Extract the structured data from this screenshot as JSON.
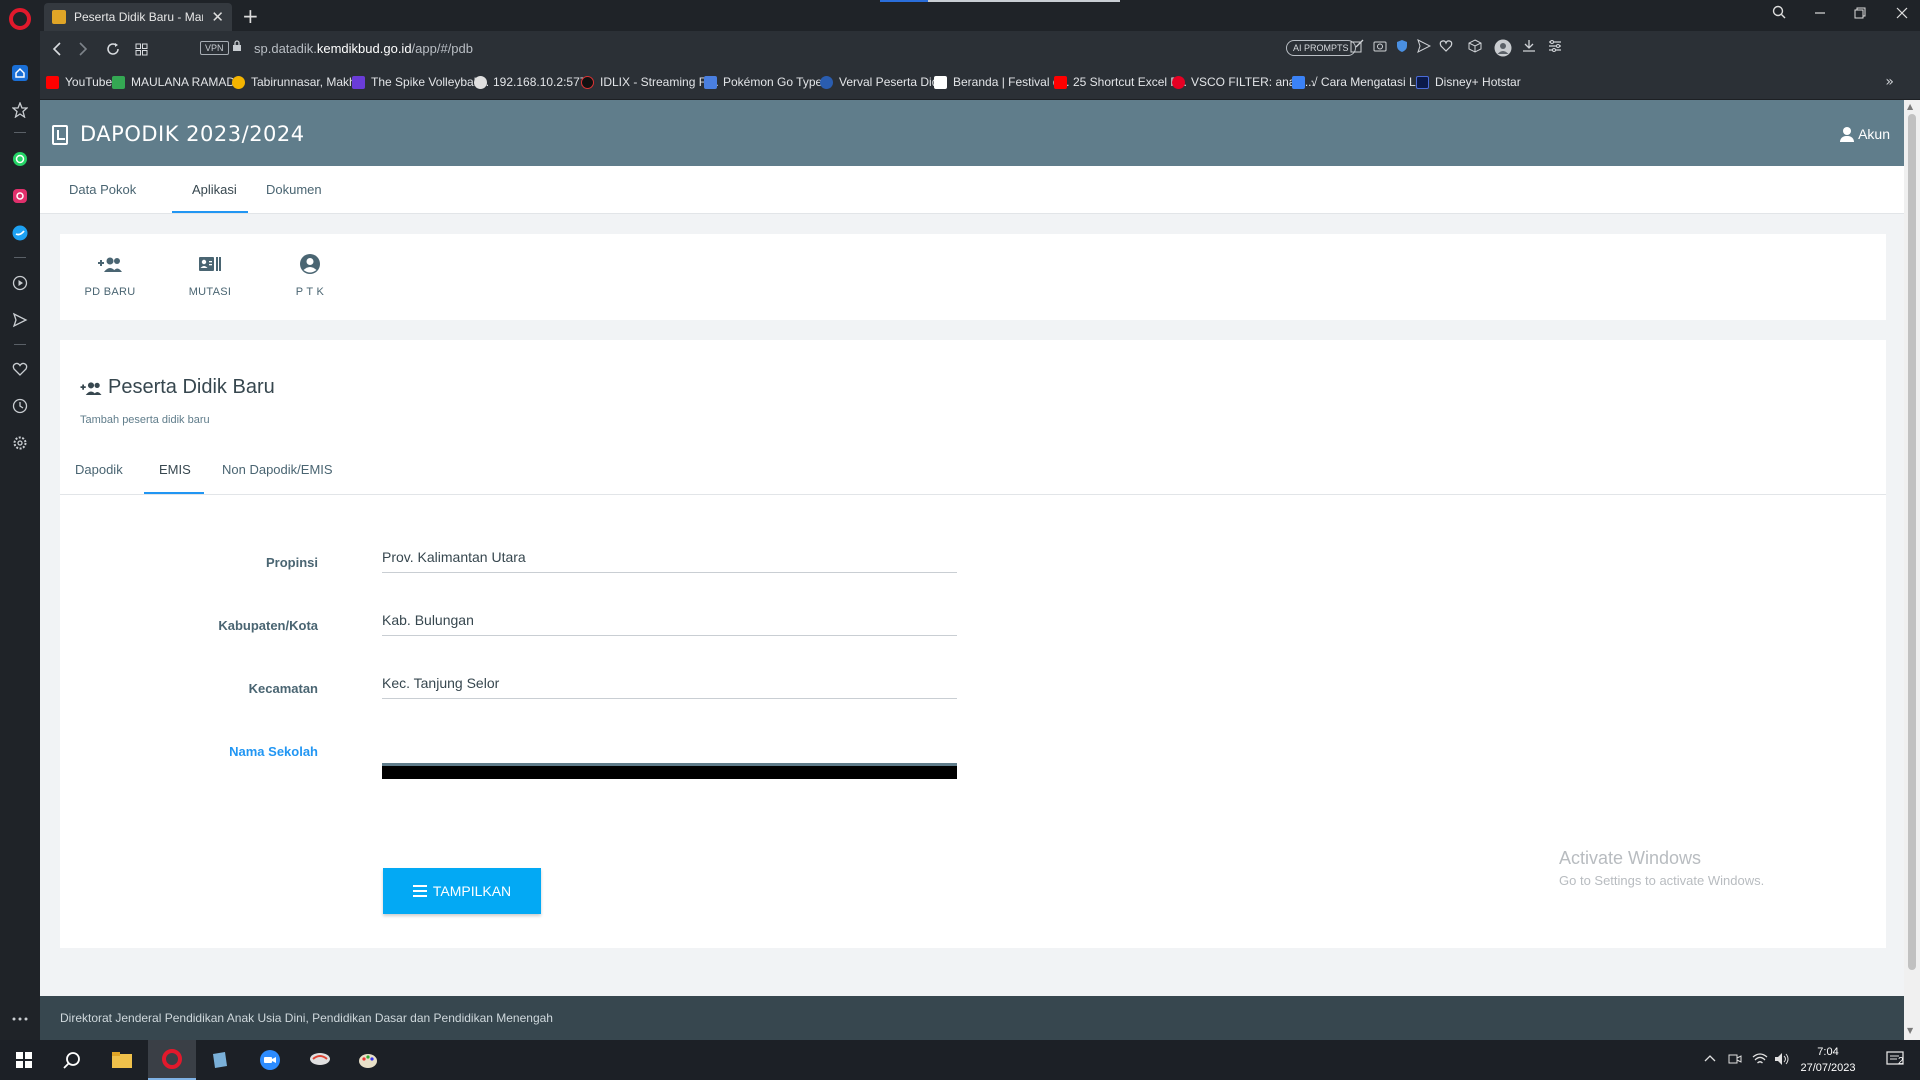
{
  "browser": {
    "tab_title": "Peserta Didik Baru - Manaj",
    "url_prefix": "sp.datadik.",
    "url_domain": "kemdikbud.go.id",
    "url_path": "/app/#/pdb",
    "vpn_label": "VPN",
    "ai_prompts_label": "AI PROMPTS",
    "new_tab": "+",
    "tab_close": "✕"
  },
  "bookmarks": [
    {
      "label": "YouTube",
      "color": "#ff0000"
    },
    {
      "label": "MAULANA RAMAD...",
      "color": "#34a853"
    },
    {
      "label": "Tabirunnasar, Makh...",
      "color": "#f4b400"
    },
    {
      "label": "The Spike Volleyball...",
      "color": "#6a3cd8"
    },
    {
      "label": "192.168.10.2:5774",
      "color": "#e0e0e0"
    },
    {
      "label": "IDLIX - Streaming Fi...",
      "color": "#111111"
    },
    {
      "label": "Pokémon Go Type...",
      "color": "#4a7fe0"
    },
    {
      "label": "Verval Peserta Didik",
      "color": "#2a5db0"
    },
    {
      "label": "Beranda | Festival d...",
      "color": "#ffffff"
    },
    {
      "label": "25 Shortcut Excel P...",
      "color": "#ff0000"
    },
    {
      "label": "VSCO FILTER: analo...",
      "color": "#e60023"
    },
    {
      "label": "√ Cara Mengatasi L...",
      "color": "#3b82f6"
    },
    {
      "label": "Disney+ Hotstar",
      "color": "#0b1a4a"
    }
  ],
  "app": {
    "title": "DAPODIK 2023/2024",
    "account_label": "Akun",
    "header_color": "#607d8b"
  },
  "main_tabs": [
    {
      "label": "Data Pokok"
    },
    {
      "label": "Aplikasi"
    },
    {
      "label": "Dokumen"
    }
  ],
  "app_buttons": [
    {
      "label": "PD BARU",
      "icon": "group-add-icon"
    },
    {
      "label": "MUTASI",
      "icon": "transfer-icon"
    },
    {
      "label": "P T K",
      "icon": "account-circle-icon"
    }
  ],
  "section": {
    "title": "Peserta Didik Baru",
    "subtitle": "Tambah peserta didik baru"
  },
  "sub_tabs": [
    {
      "label": "Dapodik"
    },
    {
      "label": "EMIS"
    },
    {
      "label": "Non Dapodik/EMIS"
    }
  ],
  "form": {
    "propinsi_label": "Propinsi",
    "propinsi_value": "Prov. Kalimantan Utara",
    "kabupaten_label": "Kabupaten/Kota",
    "kabupaten_value": "Kab. Bulungan",
    "kecamatan_label": "Kecamatan",
    "kecamatan_value": "Kec. Tanjung Selor",
    "sekolah_label": "Nama Sekolah",
    "sekolah_value": ""
  },
  "button_tampilkan": "TAMPILKAN",
  "watermark": {
    "line1": "Activate Windows",
    "line2": "Go to Settings to activate Windows."
  },
  "footer_text": "Direktorat Jenderal Pendidikan Anak Usia Dini, Pendidikan Dasar dan Pendidikan Menengah",
  "taskbar": {
    "time": "7:04",
    "date": "27/07/2023",
    "notification_count": "2"
  },
  "accent_color": "#2196f3",
  "button_color": "#03a9f4"
}
